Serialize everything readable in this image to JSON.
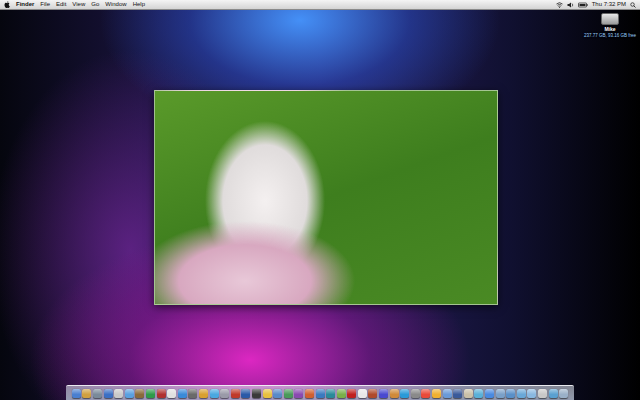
{
  "menubar": {
    "app": "Finder",
    "items": [
      "File",
      "Edit",
      "View",
      "Go",
      "Window",
      "Help"
    ],
    "clock": "Thu 7:32 PM"
  },
  "desktop_icons": [
    {
      "label": "Mike",
      "detail": "237.77 GB, 93.16 GB free"
    }
  ],
  "dock": {
    "items": [
      {
        "color": "#4a7fd0"
      },
      {
        "color": "#d0a040"
      },
      {
        "color": "#7a8a9a"
      },
      {
        "color": "#3b6fc4"
      },
      {
        "color": "#c9c9c9"
      },
      {
        "color": "#5aa0e0"
      },
      {
        "color": "#8a6a3a"
      },
      {
        "color": "#2f9a4a"
      },
      {
        "color": "#b03030"
      },
      {
        "color": "#e0e0e0"
      },
      {
        "color": "#3a8ad8"
      },
      {
        "color": "#6a6a6a"
      },
      {
        "color": "#d8a030"
      },
      {
        "color": "#4aa8e0"
      },
      {
        "color": "#9a9aa8"
      },
      {
        "color": "#c03a2a"
      },
      {
        "color": "#2a5aa8"
      },
      {
        "color": "#3a3a3a"
      },
      {
        "color": "#e8c040"
      },
      {
        "color": "#5a8ac8"
      },
      {
        "color": "#4a9a5a"
      },
      {
        "color": "#8a4ab0"
      },
      {
        "color": "#d06030"
      },
      {
        "color": "#3a7ac0"
      },
      {
        "color": "#2a8a9a"
      },
      {
        "color": "#7ab04a"
      },
      {
        "color": "#c02020"
      },
      {
        "color": "#e8e8e8"
      },
      {
        "color": "#b04a2a"
      },
      {
        "color": "#4a4ad0"
      },
      {
        "color": "#d08a3a"
      },
      {
        "color": "#2a9ad8"
      },
      {
        "color": "#8a8a8a"
      },
      {
        "color": "#e84a3a"
      },
      {
        "color": "#f0b030"
      },
      {
        "color": "#6a9ad8"
      },
      {
        "color": "#3a5a9a"
      },
      {
        "color": "#cac0a8"
      },
      {
        "color": "#5ab0d8"
      },
      {
        "color": "#4a8ae0"
      },
      {
        "color": "#7aa0c8"
      },
      {
        "color": "#5a90c8"
      },
      {
        "color": "#6aa8d8"
      },
      {
        "color": "#8ab8e0"
      },
      {
        "color": "#c8c8c8"
      },
      {
        "color": "#5aa0d0"
      },
      {
        "color": "#9ab0c8"
      }
    ]
  }
}
